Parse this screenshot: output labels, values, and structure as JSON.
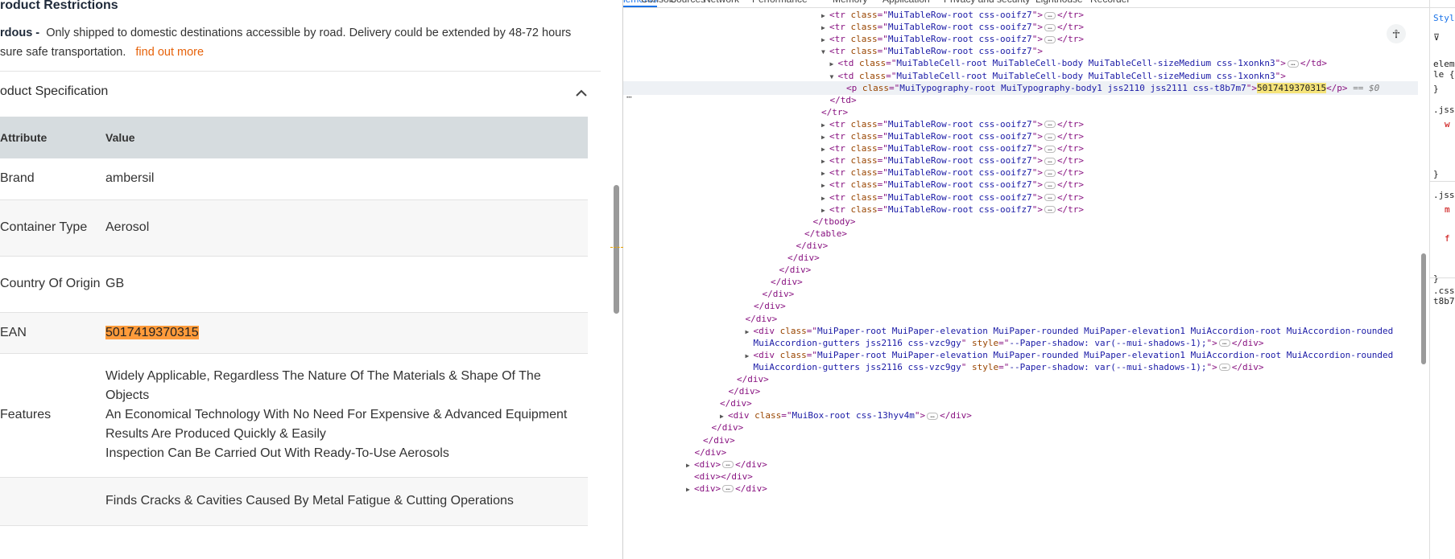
{
  "restrictions": {
    "title": "roduct Restrictions",
    "label": "rdous -",
    "text": "Only shipped to domestic destinations accessible by road. Delivery could be extended by 48-72 hours",
    "text2": "sure safe transportation.",
    "link": "find out more"
  },
  "spec": {
    "title": "oduct Specification",
    "headers": {
      "attribute": "Attribute",
      "value": "Value"
    },
    "rows": [
      {
        "attr": "Brand",
        "value": "ambersil"
      },
      {
        "attr": "Container Type",
        "value": "Aerosol"
      },
      {
        "attr": "Country Of Origin",
        "value": "GB"
      },
      {
        "attr": "EAN",
        "value": "5017419370315"
      },
      {
        "attr": "Features",
        "lines": [
          "Widely Applicable, Regardless The Nature Of The Materials & Shape Of The Objects",
          "An Economical Technology With No Need For Expensive & Advanced Equipment",
          "Results Are Produced Quickly & Easily",
          "Inspection Can Be Carried Out With Ready-To-Use Aerosols"
        ]
      },
      {
        "attr": "",
        "value": "Finds Cracks & Cavities Caused By Metal Fatigue & Cutting Operations"
      }
    ]
  },
  "devtools": {
    "tabs": [
      "Elements",
      "Console",
      "Sources",
      "Network",
      "Performance",
      "Memory",
      "Application",
      "Privacy and security",
      "Lighthouse",
      "Recorder"
    ],
    "active_tab": "Elements",
    "selected_suffix": "== $0",
    "accessibility_icon": "accessibility-icon",
    "styles_tab": "Styl",
    "styles_lines": [
      "elem",
      "le {",
      "}",
      ".jss",
      "w",
      "}",
      ".jss",
      "m",
      "f",
      "}",
      ".css",
      "t8b7"
    ],
    "colors": {
      "tag": "#881280",
      "attr_name": "#994500",
      "attr_value": "#1a1aa6",
      "highlight": "#ff9b3b"
    }
  },
  "dom_lines": [
    {
      "d": 0,
      "t": "tr",
      "cls": "MuiTableRow-root css-ooifz7",
      "col": true
    },
    {
      "d": 0,
      "t": "tr",
      "cls": "MuiTableRow-root css-ooifz7",
      "col": true
    },
    {
      "d": 0,
      "t": "tr",
      "cls": "MuiTableRow-root css-ooifz7",
      "col": true
    },
    {
      "d": 0,
      "t": "tr",
      "cls": "MuiTableRow-root css-ooifz7",
      "exp": true
    },
    {
      "d": 1,
      "t": "td",
      "cls": "MuiTableCell-root MuiTableCell-body MuiTableCell-sizeMedium css-1xonkn3",
      "col": true
    },
    {
      "d": 1,
      "t": "td",
      "cls": "MuiTableCell-root MuiTableCell-body MuiTableCell-sizeMedium css-1xonkn3",
      "exp": true
    },
    {
      "d": 2,
      "t": "p",
      "cls": "MuiTypography-root MuiTypography-body1 jss2110 jss2111 css-t8b7m7",
      "text": "5017419370315",
      "sel": true
    },
    {
      "d": 1,
      "close": "td"
    },
    {
      "d": 0,
      "close": "tr"
    },
    {
      "d": 0,
      "t": "tr",
      "cls": "MuiTableRow-root css-ooifz7",
      "col": true
    },
    {
      "d": 0,
      "t": "tr",
      "cls": "MuiTableRow-root css-ooifz7",
      "col": true
    },
    {
      "d": 0,
      "t": "tr",
      "cls": "MuiTableRow-root css-ooifz7",
      "col": true
    },
    {
      "d": 0,
      "t": "tr",
      "cls": "MuiTableRow-root css-ooifz7",
      "col": true
    },
    {
      "d": 0,
      "t": "tr",
      "cls": "MuiTableRow-root css-ooifz7",
      "col": true
    },
    {
      "d": 0,
      "t": "tr",
      "cls": "MuiTableRow-root css-ooifz7",
      "col": true
    },
    {
      "d": 0,
      "t": "tr",
      "cls": "MuiTableRow-root css-ooifz7",
      "col": true
    },
    {
      "d": 0,
      "t": "tr",
      "cls": "MuiTableRow-root css-ooifz7",
      "col": true
    },
    {
      "d": -1,
      "close": "tbody"
    },
    {
      "d": -2,
      "close": "table"
    },
    {
      "d": -3,
      "close": "div"
    },
    {
      "d": -4,
      "close": "div"
    },
    {
      "d": -5,
      "close": "div"
    },
    {
      "d": -6,
      "close": "div"
    },
    {
      "d": -7,
      "close": "div"
    },
    {
      "d": -8,
      "close": "div"
    },
    {
      "d": -9,
      "close": "div"
    },
    {
      "d": -9,
      "t": "div",
      "cls": "MuiPaper-root MuiPaper-elevation MuiPaper-rounded MuiPaper-elevation1 MuiAccordion-root MuiAccordion-rounded",
      "cont": "MuiAccordion-gutters jss2116 css-vzc9gy",
      "style": "--Paper-shadow: var(--mui-shadows-1);",
      "col": true
    },
    {
      "d": -9,
      "t": "div",
      "cls": "MuiPaper-root MuiPaper-elevation MuiPaper-rounded MuiPaper-elevation1 MuiAccordion-root MuiAccordion-rounded",
      "cont": "MuiAccordion-gutters jss2116 css-vzc9gy",
      "style": "--Paper-shadow: var(--mui-shadows-1);",
      "col": true
    },
    {
      "d": -10,
      "close": "div"
    },
    {
      "d": -11,
      "close": "div"
    },
    {
      "d": -12,
      "close": "div"
    },
    {
      "d": -12,
      "t": "div",
      "cls": "MuiBox-root css-13hyv4m",
      "col": true
    },
    {
      "d": -13,
      "close": "div"
    },
    {
      "d": -14,
      "close": "div"
    },
    {
      "d": -15,
      "close": "div"
    },
    {
      "d": -16,
      "t": "div",
      "col": true
    },
    {
      "d": -16,
      "t": "div",
      "empty": true
    },
    {
      "d": -16,
      "t": "div",
      "col": true
    }
  ]
}
